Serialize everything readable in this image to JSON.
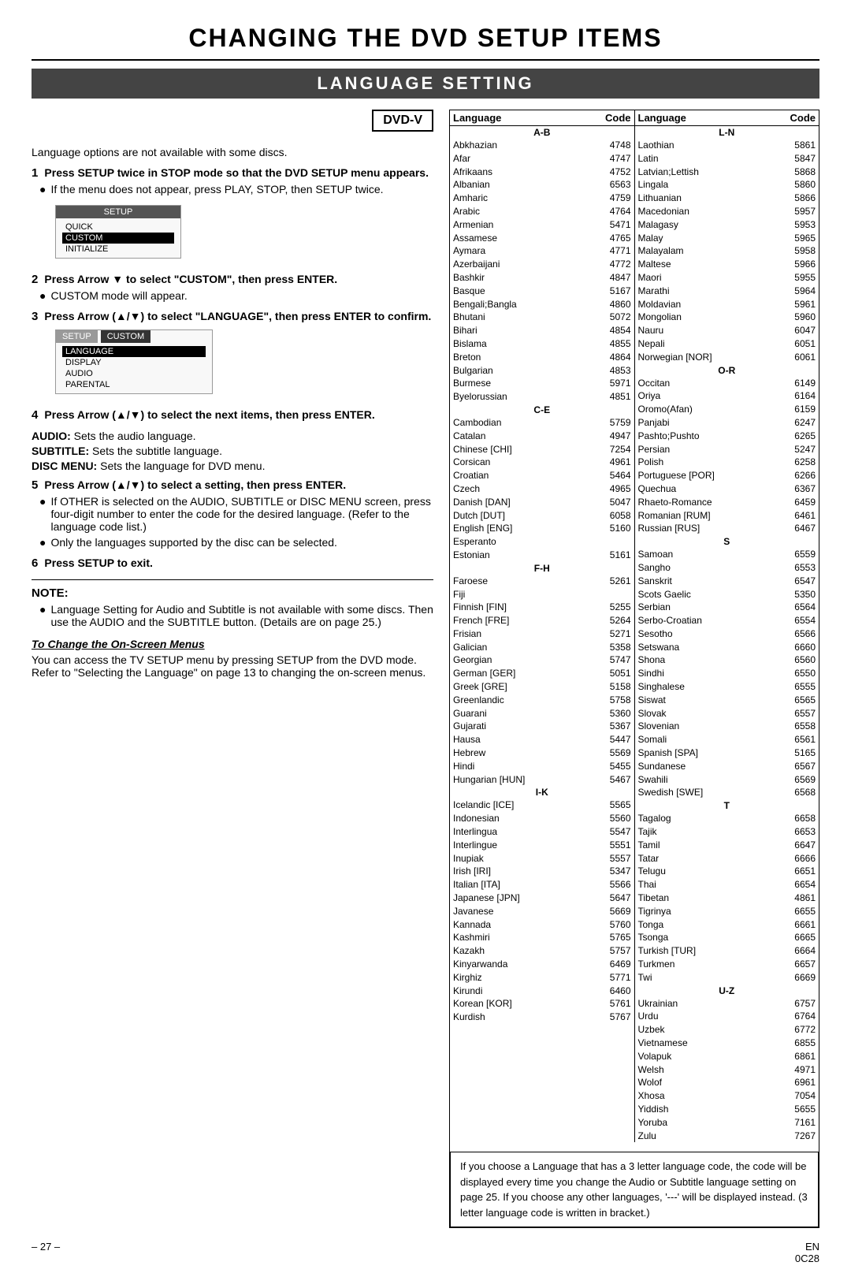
{
  "page": {
    "main_title": "CHANGING THE DVD SETUP ITEMS",
    "section_title": "LANGUAGE SETTING",
    "dvd_badge": "DVD-V",
    "intro_text": "Language options are not available with some discs.",
    "steps": [
      {
        "num": "1",
        "bold_text": "Press SETUP twice in STOP mode so that the DVD SETUP menu appears.",
        "bullets": [
          "If the menu does not appear, press PLAY, STOP, then SETUP twice."
        ]
      },
      {
        "num": "2",
        "bold_text": "Press Arrow ▼ to select \"CUSTOM\", then press ENTER.",
        "bullets": [
          "CUSTOM mode will appear."
        ]
      },
      {
        "num": "3",
        "bold_text": "Press Arrow (▲/▼) to select \"LANGUAGE\", then press ENTER to confirm.",
        "bullets": []
      },
      {
        "num": "4",
        "bold_text": "Press Arrow (▲/▼) to select the next items, then press ENTER.",
        "bullets": []
      },
      {
        "num": "4b_audio",
        "text": "AUDIO:  Sets the audio language."
      },
      {
        "num": "4b_subtitle",
        "text": "SUBTITLE:  Sets the subtitle language."
      },
      {
        "num": "4b_disc",
        "text": "DISC MENU:  Sets the language for DVD menu."
      },
      {
        "num": "5",
        "bold_text": "Press Arrow (▲/▼) to select a setting, then press ENTER.",
        "bullets": [
          "If OTHER is selected on the AUDIO, SUBTITLE or DISC MENU screen, press four-digit number to enter the code for the desired language. (Refer to the language code list.)",
          "Only the languages supported by the disc can be selected."
        ]
      },
      {
        "num": "6",
        "bold_text": "Press SETUP to exit."
      }
    ],
    "note_title": "NOTE:",
    "notes": [
      "Language Setting for Audio and Subtitle is not available with some discs. Then use the AUDIO and the SUBTITLE button. (Details are on page 25.)"
    ],
    "change_menus_title": "To Change the On-Screen Menus",
    "change_menus_text": "You can access the TV SETUP menu by pressing SETUP from the DVD mode. Refer to \"Selecting the Language\" on page 13 to changing the on-screen menus.",
    "menu1": {
      "title": "SETUP",
      "items": [
        "QUICK",
        "CUSTOM",
        "INITIALIZE"
      ],
      "selected": "CUSTOM"
    },
    "menu2": {
      "tabs": [
        "SETUP",
        "CUSTOM"
      ],
      "items": [
        "LANGUAGE",
        "DISPLAY",
        "AUDIO",
        "PARENTAL"
      ],
      "selected": "LANGUAGE"
    },
    "bottom_note": "If you choose a Language that has a 3 letter language code, the code will be displayed every time you change the Audio or Subtitle language setting on page 25. If you choose any other languages, '---' will be displayed instead. (3 letter language code is written in bracket.)",
    "footer_left": "– 27 –",
    "footer_right": "EN\n0C28"
  },
  "language_table": {
    "left_col": {
      "header": {
        "lang": "Language",
        "code": "Code"
      },
      "sections": [
        {
          "label": "A-B",
          "rows": [
            {
              "lang": "Abkhazian",
              "code": "4748"
            },
            {
              "lang": "Afar",
              "code": "4747"
            },
            {
              "lang": "Afrikaans",
              "code": "4752"
            },
            {
              "lang": "Albanian",
              "code": "6563"
            },
            {
              "lang": "Amharic",
              "code": "4759"
            },
            {
              "lang": "Arabic",
              "code": "4764"
            },
            {
              "lang": "Armenian",
              "code": "5471"
            },
            {
              "lang": "Assamese",
              "code": "4765"
            },
            {
              "lang": "Aymara",
              "code": "4771"
            },
            {
              "lang": "Azerbaijani",
              "code": "4772"
            },
            {
              "lang": "Bashkir",
              "code": "4847"
            },
            {
              "lang": "Basque",
              "code": "5167"
            },
            {
              "lang": "Bengali;Bangla",
              "code": "4860"
            },
            {
              "lang": "Bhutani",
              "code": "5072"
            },
            {
              "lang": "Bihari",
              "code": "4854"
            },
            {
              "lang": "Bislama",
              "code": "4855"
            },
            {
              "lang": "Breton",
              "code": "4864"
            },
            {
              "lang": "Bulgarian",
              "code": "4853"
            },
            {
              "lang": "Burmese",
              "code": "5971"
            },
            {
              "lang": "Byelorussian",
              "code": "4851"
            }
          ]
        },
        {
          "label": "C-E",
          "rows": [
            {
              "lang": "Cambodian",
              "code": "5759"
            },
            {
              "lang": "Catalan",
              "code": "4947"
            },
            {
              "lang": "Chinese [CHI]",
              "code": "7254"
            },
            {
              "lang": "Corsican",
              "code": "4961"
            },
            {
              "lang": "Croatian",
              "code": "5464"
            },
            {
              "lang": "Czech",
              "code": "4965"
            },
            {
              "lang": "Danish [DAN]",
              "code": "5047"
            },
            {
              "lang": "Dutch [DUT]",
              "code": "6058"
            },
            {
              "lang": "English [ENG]",
              "code": "5160"
            },
            {
              "lang": "Esperanto",
              "code": ""
            },
            {
              "lang": "Estonian",
              "code": "5161"
            }
          ]
        },
        {
          "label": "F-H",
          "rows": [
            {
              "lang": "Faroese",
              "code": "5261"
            },
            {
              "lang": "Fiji",
              "code": ""
            },
            {
              "lang": "Finnish [FIN]",
              "code": "5255"
            },
            {
              "lang": "French [FRE]",
              "code": "5264"
            },
            {
              "lang": "Frisian",
              "code": "5271"
            },
            {
              "lang": "Galician",
              "code": "5358"
            },
            {
              "lang": "Georgian",
              "code": "5747"
            },
            {
              "lang": "German [GER]",
              "code": "5051"
            },
            {
              "lang": "Greek [GRE]",
              "code": "5158"
            },
            {
              "lang": "Greenlandic",
              "code": "5758"
            },
            {
              "lang": "Guarani",
              "code": "5360"
            },
            {
              "lang": "Gujarati",
              "code": "5367"
            },
            {
              "lang": "Hausa",
              "code": "5447"
            },
            {
              "lang": "Hebrew",
              "code": "5569"
            },
            {
              "lang": "Hindi",
              "code": "5455"
            },
            {
              "lang": "Hungarian [HUN]",
              "code": "5467"
            }
          ]
        },
        {
          "label": "I-K",
          "rows": [
            {
              "lang": "Icelandic [ICE]",
              "code": "5565"
            },
            {
              "lang": "Indonesian",
              "code": "5560"
            },
            {
              "lang": "Interlingua",
              "code": "5547"
            },
            {
              "lang": "Interlingue",
              "code": "5551"
            },
            {
              "lang": "Inupiak",
              "code": "5557"
            },
            {
              "lang": "Irish [IRI]",
              "code": "5347"
            },
            {
              "lang": "Italian [ITA]",
              "code": "5566"
            },
            {
              "lang": "Japanese [JPN]",
              "code": "5647"
            },
            {
              "lang": "Javanese",
              "code": "5669"
            },
            {
              "lang": "Kannada",
              "code": "5760"
            },
            {
              "lang": "Kashmiri",
              "code": "5765"
            },
            {
              "lang": "Kazakh",
              "code": "5757"
            },
            {
              "lang": "Kinyarwanda",
              "code": "6469"
            },
            {
              "lang": "Kirghiz",
              "code": "5771"
            },
            {
              "lang": "Kirundi",
              "code": "6460"
            },
            {
              "lang": "Korean [KOR]",
              "code": "5761"
            },
            {
              "lang": "Kurdish",
              "code": "5767"
            }
          ]
        }
      ]
    },
    "right_col": {
      "header": {
        "lang": "Language",
        "code": "Code"
      },
      "sections": [
        {
          "label": "L-N",
          "rows": [
            {
              "lang": "Laothian",
              "code": "5861"
            },
            {
              "lang": "Latin",
              "code": "5847"
            },
            {
              "lang": "Latvian;Lettish",
              "code": "5868"
            },
            {
              "lang": "Lingala",
              "code": "5860"
            },
            {
              "lang": "Lithuanian",
              "code": "5866"
            },
            {
              "lang": "Macedonian",
              "code": "5957"
            },
            {
              "lang": "Malagasy",
              "code": "5953"
            },
            {
              "lang": "Malay",
              "code": "5965"
            },
            {
              "lang": "Malayalam",
              "code": "5958"
            },
            {
              "lang": "Maltese",
              "code": "5966"
            },
            {
              "lang": "Maori",
              "code": "5955"
            },
            {
              "lang": "Marathi",
              "code": "5964"
            },
            {
              "lang": "Moldavian",
              "code": "5961"
            },
            {
              "lang": "Mongolian",
              "code": "5960"
            },
            {
              "lang": "Nauru",
              "code": "6047"
            },
            {
              "lang": "Nepali",
              "code": "6051"
            },
            {
              "lang": "Norwegian [NOR]",
              "code": "6061"
            }
          ]
        },
        {
          "label": "O-R",
          "rows": [
            {
              "lang": "Occitan",
              "code": "6149"
            },
            {
              "lang": "Oriya",
              "code": "6164"
            },
            {
              "lang": "Oromo(Afan)",
              "code": "6159"
            },
            {
              "lang": "Panjabi",
              "code": "6247"
            },
            {
              "lang": "Pashto;Pushto",
              "code": "6265"
            },
            {
              "lang": "Persian",
              "code": "5247"
            },
            {
              "lang": "Polish",
              "code": "6258"
            },
            {
              "lang": "Portuguese [POR]",
              "code": "6266"
            },
            {
              "lang": "Quechua",
              "code": "6367"
            },
            {
              "lang": "Rhaeto-Romance",
              "code": "6459"
            },
            {
              "lang": "Romanian [RUM]",
              "code": "6461"
            },
            {
              "lang": "Russian [RUS]",
              "code": "6467"
            }
          ]
        },
        {
          "label": "S",
          "rows": [
            {
              "lang": "Samoan",
              "code": "6559"
            },
            {
              "lang": "Sangho",
              "code": "6553"
            },
            {
              "lang": "Sanskrit",
              "code": "6547"
            },
            {
              "lang": "Scots Gaelic",
              "code": "5350"
            },
            {
              "lang": "Serbian",
              "code": "6564"
            },
            {
              "lang": "Serbo-Croatian",
              "code": "6554"
            },
            {
              "lang": "Sesotho",
              "code": "6566"
            },
            {
              "lang": "Setswana",
              "code": "6660"
            },
            {
              "lang": "Shona",
              "code": "6560"
            },
            {
              "lang": "Sindhi",
              "code": "6550"
            },
            {
              "lang": "Singhalese",
              "code": "6555"
            },
            {
              "lang": "Siswat",
              "code": "6565"
            },
            {
              "lang": "Slovak",
              "code": "6557"
            },
            {
              "lang": "Slovenian",
              "code": "6558"
            },
            {
              "lang": "Somali",
              "code": "6561"
            },
            {
              "lang": "Spanish [SPA]",
              "code": "5165"
            },
            {
              "lang": "Sundanese",
              "code": "6567"
            },
            {
              "lang": "Swahili",
              "code": "6569"
            },
            {
              "lang": "Swedish [SWE]",
              "code": "6568"
            }
          ]
        },
        {
          "label": "T",
          "rows": [
            {
              "lang": "Tagalog",
              "code": "6658"
            },
            {
              "lang": "Tajik",
              "code": "6653"
            },
            {
              "lang": "Tamil",
              "code": "6647"
            },
            {
              "lang": "Tatar",
              "code": "6666"
            },
            {
              "lang": "Telugu",
              "code": "6651"
            },
            {
              "lang": "Thai",
              "code": "6654"
            },
            {
              "lang": "Tibetan",
              "code": "4861"
            },
            {
              "lang": "Tigrinya",
              "code": "6655"
            },
            {
              "lang": "Tonga",
              "code": "6661"
            },
            {
              "lang": "Tsonga",
              "code": "6665"
            },
            {
              "lang": "Turkish [TUR]",
              "code": "6664"
            },
            {
              "lang": "Turkmen",
              "code": "6657"
            },
            {
              "lang": "Twi",
              "code": "6669"
            }
          ]
        },
        {
          "label": "U-Z",
          "rows": [
            {
              "lang": "Ukrainian",
              "code": "6757"
            },
            {
              "lang": "Urdu",
              "code": "6764"
            },
            {
              "lang": "Uzbek",
              "code": "6772"
            },
            {
              "lang": "Vietnamese",
              "code": "6855"
            },
            {
              "lang": "Volapuk",
              "code": "6861"
            },
            {
              "lang": "Welsh",
              "code": "4971"
            },
            {
              "lang": "Wolof",
              "code": "6961"
            },
            {
              "lang": "Xhosa",
              "code": "7054"
            },
            {
              "lang": "Yiddish",
              "code": "5655"
            },
            {
              "lang": "Yoruba",
              "code": "7161"
            },
            {
              "lang": "Zulu",
              "code": "7267"
            }
          ]
        }
      ]
    }
  }
}
